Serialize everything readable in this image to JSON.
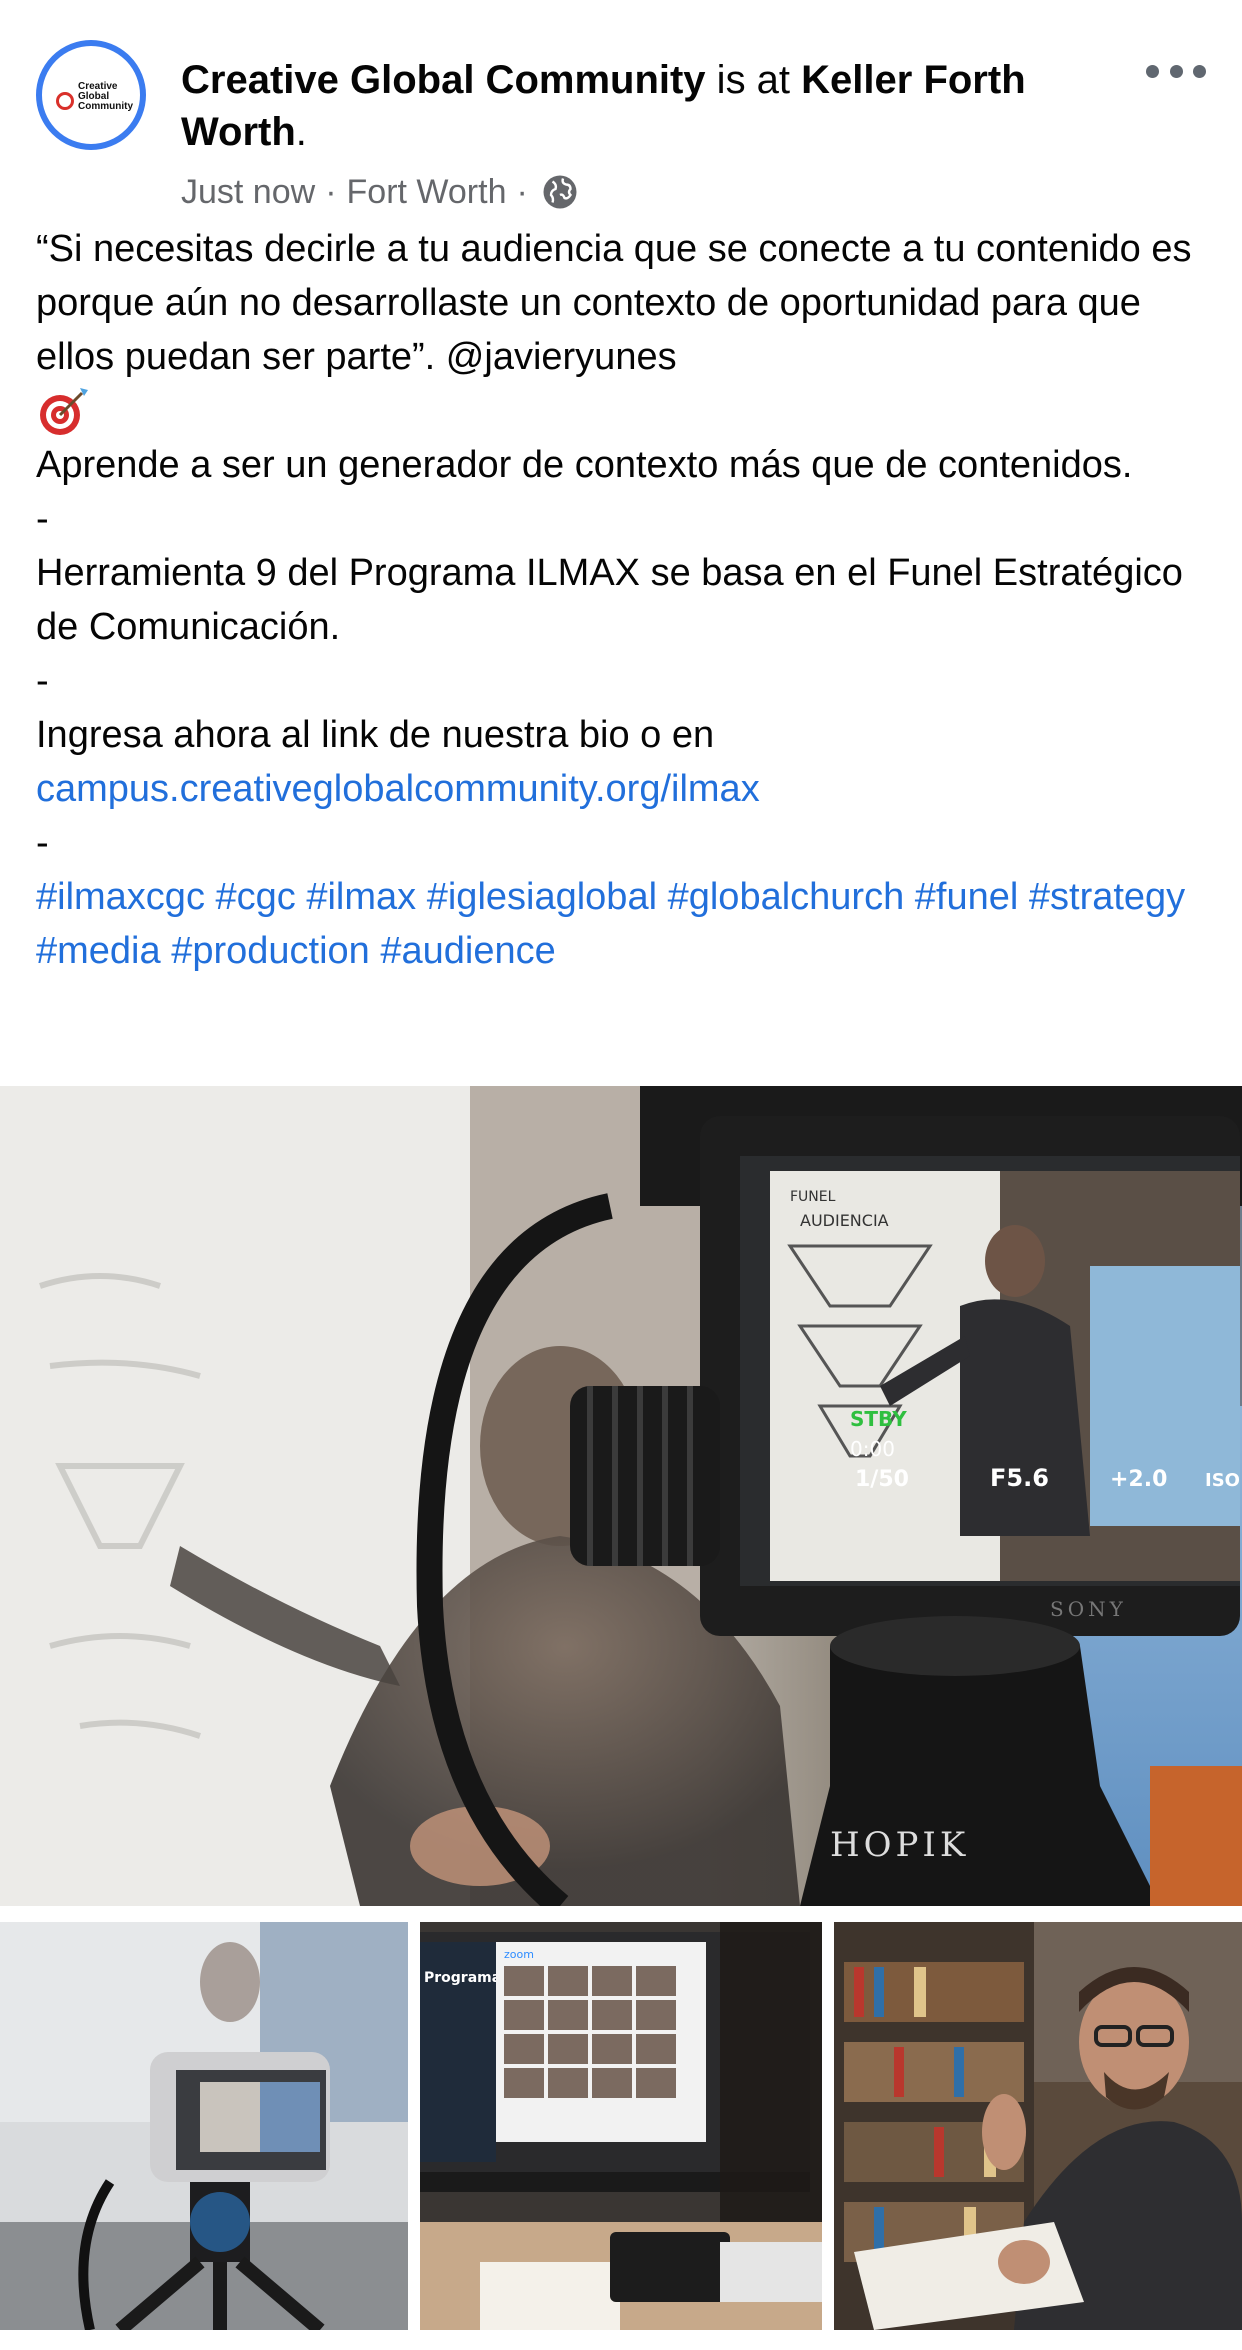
{
  "header": {
    "page_name": "Creative Global Community",
    "connector": " is at ",
    "place_name": "Keller Forth Worth",
    "suffix": ".",
    "time": "Just now",
    "location": "Fort Worth",
    "privacy_icon": "globe-icon",
    "more_icon": "more-options-icon",
    "avatar_text": [
      "Creative",
      "Global",
      "Community"
    ]
  },
  "post": {
    "quote": "“Si necesitas decirle a tu audiencia que se conecte a tu contenido es porque aún no desarrollaste un contexto de oportunidad para que ellos puedan ser parte”. @javieryunes",
    "emoji": "target-emoji",
    "line1": "Aprende a ser un generador de contexto más que de contenidos.",
    "sep1": "-",
    "line2": "Herramienta 9 del Programa ILMAX se basa en el Funel Estratégico de Comunicación.",
    "sep2": "-",
    "line3": "Ingresa ahora al link de nuestra bio o en",
    "link": "campus.creativeglobalcommunity.org/ilmax",
    "sep3": "-",
    "hashtags": [
      "#ilmaxcgc",
      "#cgc",
      "#ilmax",
      "#iglesiaglobal",
      "#globalchurch",
      "#funel",
      "#strategy",
      "#media",
      "#production",
      "#audience"
    ]
  },
  "photos": {
    "main": {
      "screen_label_1": "FUNEL",
      "screen_label_2": "AUDIENCIA",
      "stby": "STBY",
      "timecode": "0:00",
      "shutter": "1/50",
      "aperture": "F5.6",
      "exposure": "+2.0",
      "iso": "ISO",
      "brand": "SONY",
      "tripod_brand": "HOPIK"
    },
    "second": {
      "screen_text": "Programa ILMAX",
      "app_label": "zoom"
    }
  },
  "colors": {
    "link": "#216fdb",
    "avatar_ring": "#3b7cf0",
    "meta": "#65676b"
  }
}
